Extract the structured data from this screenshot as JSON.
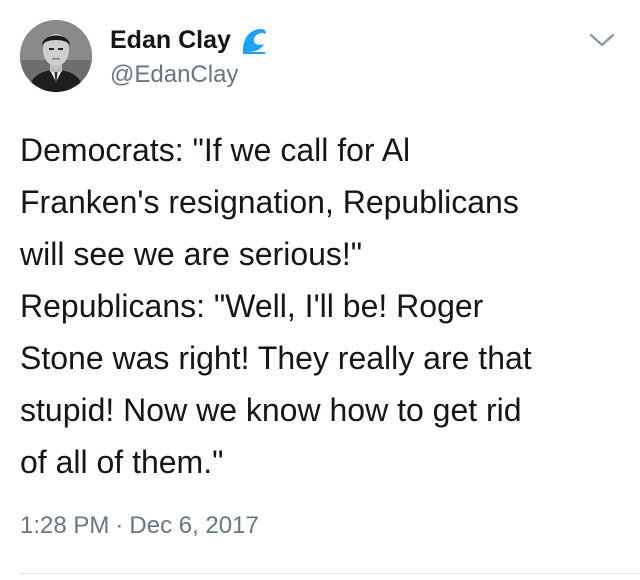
{
  "user": {
    "display_name": "Edan Clay",
    "handle": "@EdanClay",
    "badge_icon": "wave-icon",
    "avatar_icon": "profile-photo"
  },
  "tweet": {
    "lines": [
      "Democrats: \"If we call for Al",
      "Franken's resignation, Republicans",
      "will see we are serious!\"",
      "Republicans: \"Well, I'll be! Roger",
      "Stone was right! They really are that",
      "stupid! Now we know how to get rid",
      "of all of them.\""
    ],
    "time": "1:28 PM",
    "separator": "·",
    "date": "Dec 6, 2017"
  },
  "controls": {
    "more_icon": "chevron-down-icon"
  },
  "colors": {
    "text": "#14171a",
    "secondary": "#657786",
    "wave_blue": "#1da1f2",
    "divider": "#e1e8ed"
  }
}
